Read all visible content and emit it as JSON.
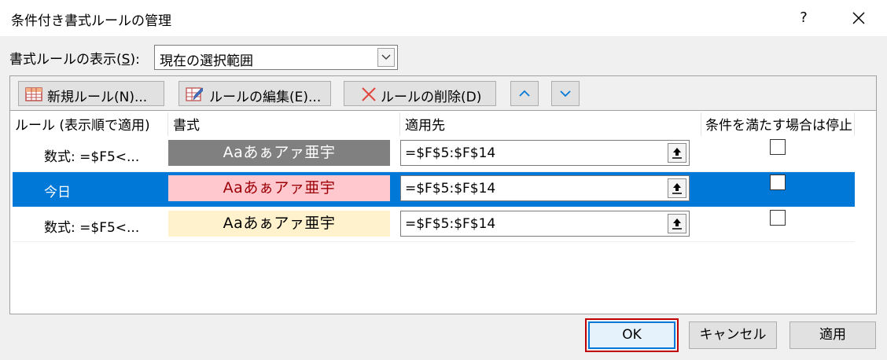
{
  "window": {
    "title": "条件付き書式ルールの管理",
    "help_label": "?"
  },
  "scope": {
    "label_prefix": "書式ルールの表示(",
    "label_key": "S",
    "label_suffix": "):",
    "value": "現在の選択範囲"
  },
  "toolbar": {
    "new_rule": "新規ルール(N)...",
    "edit_rule": "ルールの編集(E)...",
    "delete_rule": "ルールの削除(D)"
  },
  "table": {
    "headers": {
      "rule": "ルール (表示順で適用)",
      "format": "書式",
      "applies_to": "適用先",
      "stop_if_true": "条件を満たす場合は停止"
    },
    "rows": [
      {
        "name": "数式: =$F5<...",
        "preview_text": "Aaあぁアァ亜宇",
        "preview_bg": "#808080",
        "preview_fg": "#ffffff",
        "range": "=$F$5:$F$14",
        "stop": false,
        "selected": false
      },
      {
        "name": "今日",
        "preview_text": "Aaあぁアァ亜宇",
        "preview_bg": "#ffc7ce",
        "preview_fg": "#9c0006",
        "range": "=$F$5:$F$14",
        "stop": false,
        "selected": true
      },
      {
        "name": "数式: =$F5<...",
        "preview_text": "Aaあぁアァ亜宇",
        "preview_bg": "#fff2cc",
        "preview_fg": "#000000",
        "range": "=$F$5:$F$14",
        "stop": false,
        "selected": false
      }
    ]
  },
  "buttons": {
    "ok": "OK",
    "cancel": "キャンセル",
    "apply": "適用"
  },
  "colors": {
    "accent": "#0078d7",
    "highlight_outline": "#c00000"
  }
}
